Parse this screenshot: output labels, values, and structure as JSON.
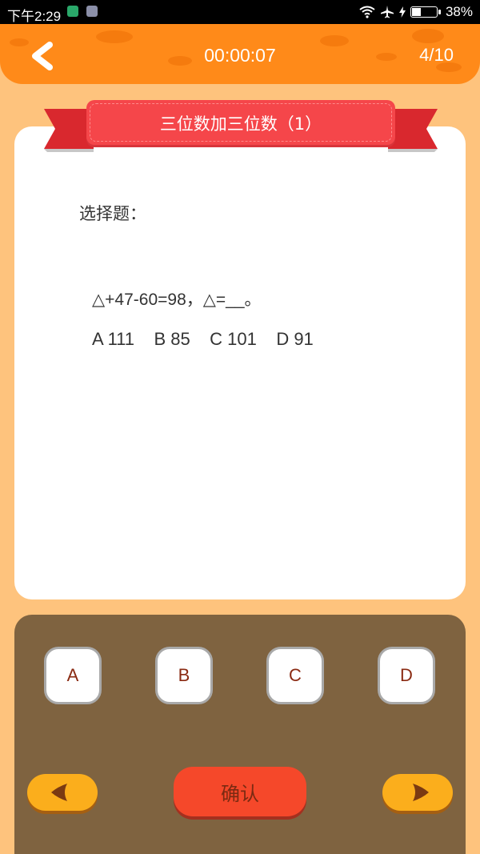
{
  "status_bar": {
    "time": "下午2:29",
    "battery": "38%",
    "battery_level": 0.38
  },
  "header": {
    "timer": "00:00:07",
    "progress": "4/10"
  },
  "lesson": {
    "title": "三位数加三位数（1）"
  },
  "question": {
    "type_label": "选择题：",
    "text": "△+47-60=98，△=__。",
    "options_line": "A 111    B 85    C 101    D 91"
  },
  "answers": {
    "options": [
      "A",
      "B",
      "C",
      "D"
    ],
    "confirm_label": "确认"
  },
  "colors": {
    "header": "#ff8a19",
    "background": "#fec37d",
    "ribbon": "#f5464a",
    "panel": "#7f6340",
    "confirm": "#f5482a",
    "nav": "#fbae1c"
  }
}
